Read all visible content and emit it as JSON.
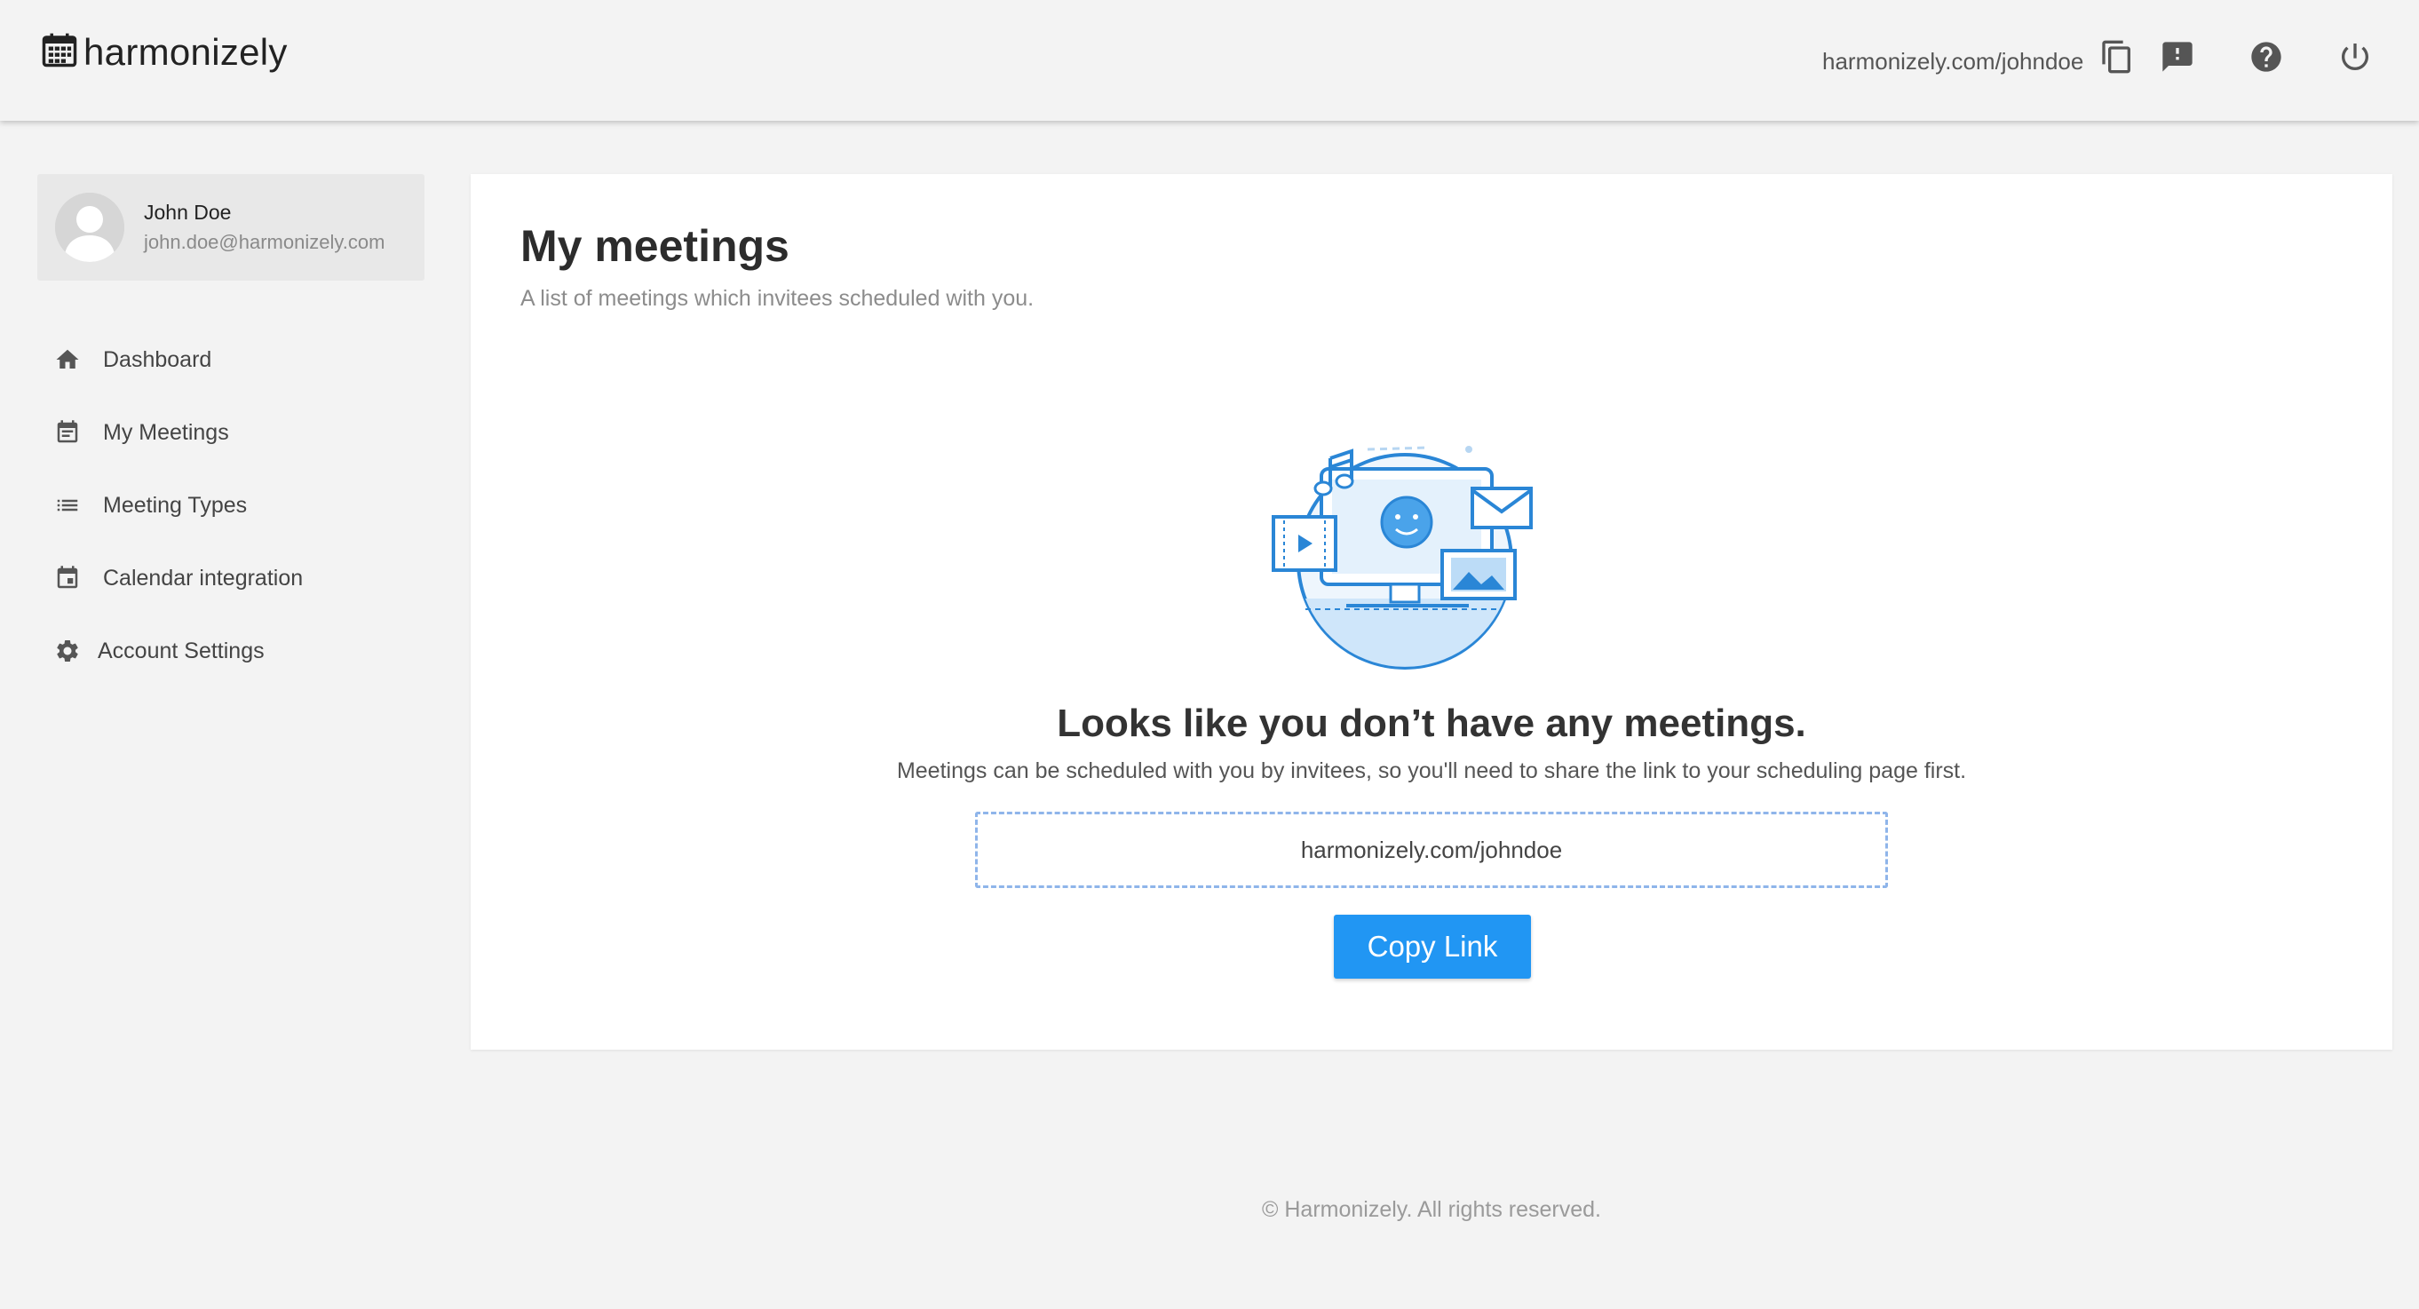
{
  "header": {
    "brand": "harmonizely",
    "scheduling_link": "harmonizely.com/johndoe",
    "icons": [
      "copy-icon",
      "feedback-icon",
      "help-icon",
      "power-icon"
    ]
  },
  "profile": {
    "name": "John Doe",
    "email": "john.doe@harmonizely.com"
  },
  "sidebar": {
    "items": [
      {
        "label": "Dashboard",
        "icon": "home-icon"
      },
      {
        "label": "My Meetings",
        "icon": "calendar-list-icon"
      },
      {
        "label": "Meeting Types",
        "icon": "list-icon"
      },
      {
        "label": "Calendar integration",
        "icon": "calendar-icon"
      },
      {
        "label": "Account Settings",
        "icon": "gear-icon"
      }
    ]
  },
  "main": {
    "title": "My meetings",
    "subtitle": "A list of meetings which invitees scheduled with you.",
    "empty_title": "Looks like you don’t have any meetings.",
    "empty_description": "Meetings can be scheduled with you by invitees, so you'll need to share the link to your scheduling page first.",
    "link": "harmonizely.com/johndoe",
    "copy_button": "Copy Link"
  },
  "footer": {
    "text": "© Harmonizely. All rights reserved."
  },
  "colors": {
    "accent": "#2196f3",
    "background": "#f3f3f3",
    "card": "#ffffff",
    "dashed_border": "#8fb5ea"
  }
}
